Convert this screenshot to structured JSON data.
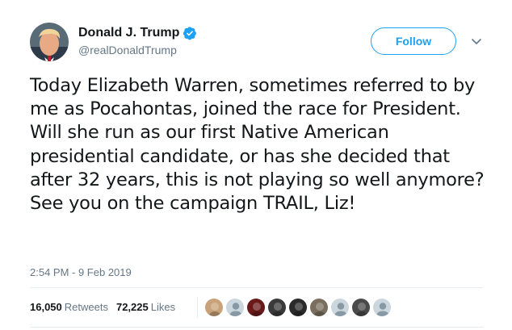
{
  "author": {
    "display_name": "Donald J. Trump",
    "handle": "@realDonaldTrump",
    "verified": true,
    "verified_icon": "verified-badge-icon"
  },
  "follow_button": {
    "label": "Follow"
  },
  "caret_icon": "chevron-down-icon",
  "tweet": {
    "text": "Today Elizabeth Warren, sometimes referred to by me as Pocahontas, joined the race for President. Will she run as our first Native American presidential candidate, or has she decided that after 32 years, this is not playing so well anymore? See you on the campaign TRAIL, Liz!",
    "timestamp": "2:54 PM - 9 Feb 2019"
  },
  "stats": {
    "retweets_count": "16,050",
    "retweets_label": "Retweets",
    "likes_count": "72,225",
    "likes_label": "Likes"
  },
  "likers": [
    {
      "name": "liker-avatar-1",
      "color": "#c9a27a"
    },
    {
      "name": "liker-avatar-2",
      "color": "#b8c2cc"
    },
    {
      "name": "liker-avatar-3",
      "color": "#6b1a1a"
    },
    {
      "name": "liker-avatar-4",
      "color": "#3a3a3a"
    },
    {
      "name": "liker-avatar-5",
      "color": "#2b2b2b"
    },
    {
      "name": "liker-avatar-6",
      "color": "#7a6f5e"
    },
    {
      "name": "liker-avatar-7",
      "color": "#b8c2cc"
    },
    {
      "name": "liker-avatar-8",
      "color": "#4a4a4a"
    },
    {
      "name": "liker-avatar-9",
      "color": "#b8c2cc"
    }
  ],
  "colors": {
    "accent": "#1da1f2",
    "text": "#14171a",
    "secondary": "#657786",
    "divider": "#e6ecf0"
  }
}
